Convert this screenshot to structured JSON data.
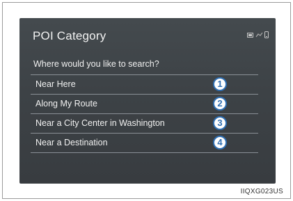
{
  "screen": {
    "title": "POI Category",
    "question": "Where would you like to search?",
    "status_icons": [
      "battery-icon",
      "signal-icon",
      "phone-icon"
    ],
    "options": [
      {
        "label": "Near Here",
        "callout": "1"
      },
      {
        "label": "Along My Route",
        "callout": "2"
      },
      {
        "label": "Near a City Center in Washington",
        "callout": "3"
      },
      {
        "label": "Near a Destination",
        "callout": "4"
      }
    ]
  },
  "caption": "IIQXG023US",
  "colors": {
    "screen_background": "#3d4246",
    "callout_accent": "#2f6fb3",
    "divider": "#8a9096"
  }
}
